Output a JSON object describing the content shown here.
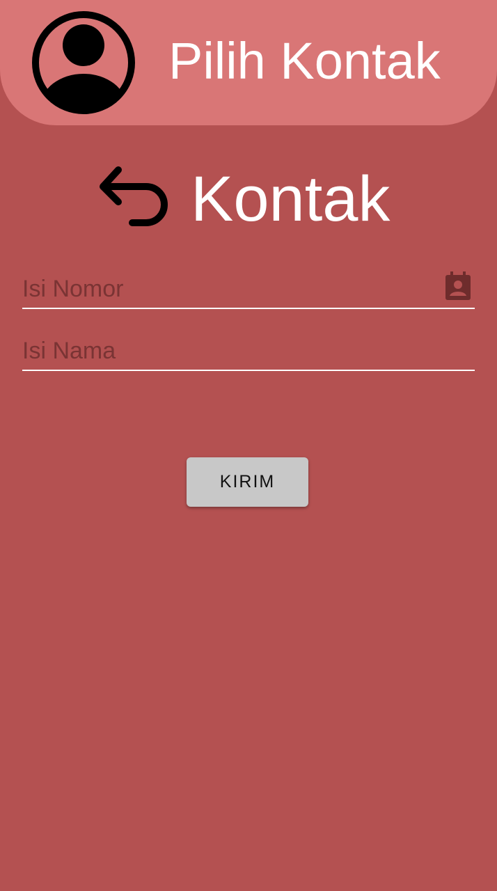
{
  "header": {
    "title": "Pilih Kontak",
    "avatar_icon": "account-circle-icon"
  },
  "main": {
    "back_icon": "undo-arrow-icon",
    "title": "Kontak"
  },
  "form": {
    "number_field": {
      "placeholder": "Isi Nomor",
      "value": "",
      "icon": "contact-book-icon"
    },
    "name_field": {
      "placeholder": "Isi Nama",
      "value": ""
    },
    "submit_label": "KIRIM"
  },
  "colors": {
    "background": "#b45151",
    "header": "#d97676",
    "button": "#c8c8c8",
    "text": "#ffffff"
  }
}
